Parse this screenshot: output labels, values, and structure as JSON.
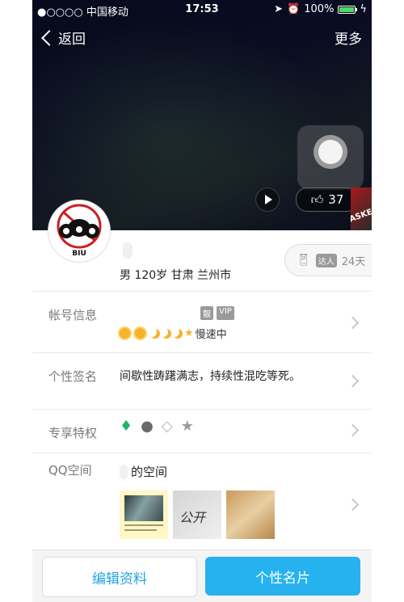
{
  "status": {
    "carrier": "●○○○○ 中国移动",
    "time": "17:53",
    "battery": "100%",
    "battery_level": 1.0
  },
  "nav": {
    "back_label": "返回",
    "more_label": "更多"
  },
  "hero": {
    "likes": "37",
    "promo_text": "ASKE"
  },
  "avatar": {
    "text": "BIU"
  },
  "profile": {
    "info": "男  120岁  甘肃 兰州市"
  },
  "badge": {
    "tag": "达人",
    "days": "24天"
  },
  "account": {
    "label": "帐号信息",
    "tag1": "靓",
    "tag2": "VIP",
    "speed": "慢速中"
  },
  "signature": {
    "label": "个性签名",
    "text": "间歇性踌躇满志，持续性混吃等死。"
  },
  "privileges": {
    "label": "专享特权"
  },
  "qzone": {
    "label": "QQ空间",
    "title": "的空间",
    "thumb2_text": "公开"
  },
  "actions": {
    "edit_label": "编辑资料",
    "card_label": "个性名片"
  },
  "colors": {
    "accent": "#26b2ee",
    "link": "#1fa4e6",
    "star": "#f5b32b"
  }
}
